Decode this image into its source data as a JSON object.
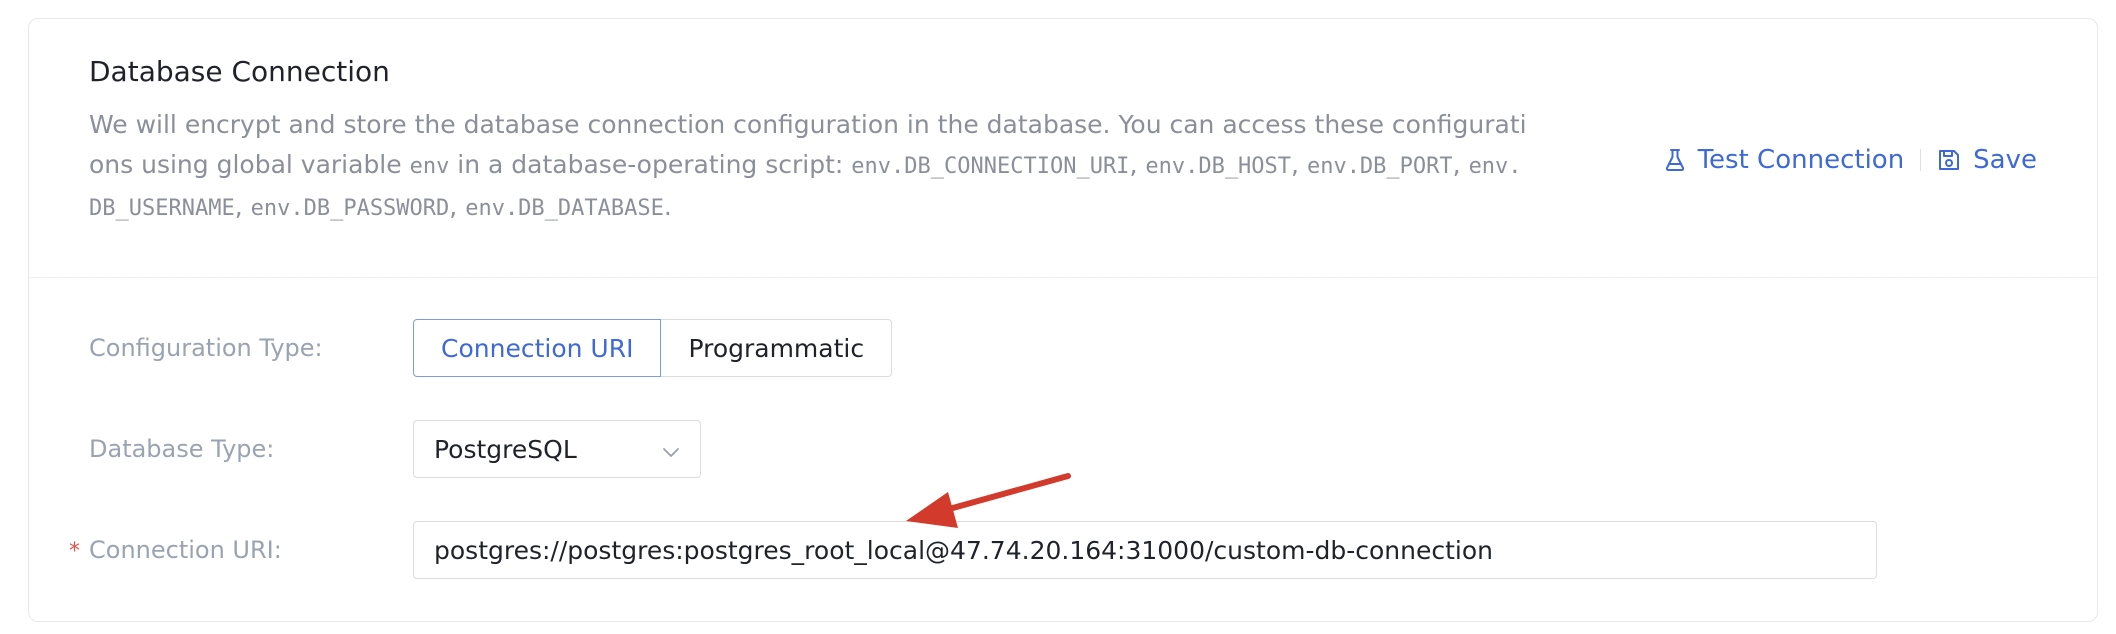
{
  "card": {
    "title": "Database Connection",
    "description": {
      "p1": "We will encrypt and store the database connection configuration in the database. You can access these configurations using global variable ",
      "var_env": "env",
      "p2": " in a database-operating script: ",
      "var_uri": "env.DB_CONNECTION_URI",
      "sep1": ", ",
      "var_host": "env.DB_HOST",
      "sep2": ", ",
      "var_port": "env.DB_PORT",
      "sep3": ", ",
      "var_username": "env.DB_USERNAME",
      "sep4": ", ",
      "var_password": "env.DB_PASSWORD",
      "sep5": ", ",
      "var_database": "env.DB_DATABASE",
      "end": "."
    },
    "actions": {
      "test_label": "Test Connection",
      "test_icon": "flask-icon",
      "save_label": "Save",
      "save_icon": "save-icon"
    }
  },
  "form": {
    "config_type": {
      "label": "Configuration Type:",
      "options": [
        "Connection URI",
        "Programmatic"
      ],
      "selected": "Connection URI"
    },
    "db_type": {
      "label": "Database Type:",
      "value": "PostgreSQL",
      "icon": "chevron-down-icon"
    },
    "connection_uri": {
      "label": "Connection URI:",
      "required_mark": "*",
      "value": "postgres://postgres:postgres_root_local@47.74.20.164:31000/custom-db-connection"
    }
  },
  "colors": {
    "accent": "#3e69d6",
    "annotation_arrow": "#d23a2c",
    "required": "#e0534a"
  }
}
